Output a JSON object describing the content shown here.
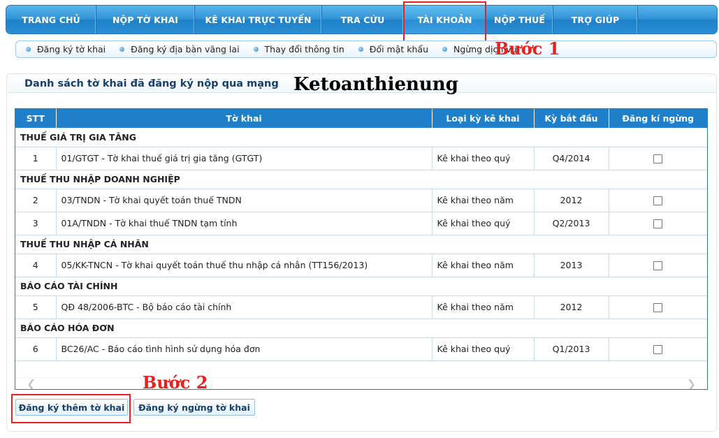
{
  "nav": {
    "items": [
      {
        "label": "TRANG CHỦ"
      },
      {
        "label": "NỘP TỜ KHAI"
      },
      {
        "label": "KÊ KHAI TRỰC TUYẾN"
      },
      {
        "label": "TRA CỨU"
      },
      {
        "label": "TÀI KHOẢN"
      },
      {
        "label": "NỘP THUẾ"
      },
      {
        "label": "TRỢ GIÚP"
      }
    ],
    "active": "TÀI KHOẢN"
  },
  "subnav": {
    "items": [
      {
        "label": "Đăng ký tờ khai"
      },
      {
        "label": "Đăng ký địa bàn vãng lai"
      },
      {
        "label": "Thay đổi thông tin"
      },
      {
        "label": "Đổi mật khẩu"
      },
      {
        "label": "Ngừng dịch vụ"
      }
    ]
  },
  "annotations": {
    "step1": "Bước 1",
    "step2": "Bước 2",
    "watermark": "Ketoanthienung",
    "highlight_color": "#e8211d"
  },
  "panel": {
    "title": "Danh sách tờ khai đã đăng ký nộp qua mạng"
  },
  "table": {
    "headers": [
      "STT",
      "Tờ khai",
      "Loại kỳ kê khai",
      "Kỳ bắt đầu",
      "Đăng kí ngừng"
    ],
    "groups": [
      {
        "name": "THUẾ GIÁ TRỊ GIA TĂNG",
        "rows": [
          {
            "stt": "1",
            "form": "01/GTGT - Tờ khai thuế giá trị gia tăng (GTGT)",
            "period_type": "Kê khai theo quý",
            "start": "Q4/2014",
            "checked": false
          }
        ]
      },
      {
        "name": "THUẾ THU NHẬP DOANH NGHIỆP",
        "rows": [
          {
            "stt": "2",
            "form": "03/TNDN - Tờ khai quyết toán thuế TNDN",
            "period_type": "Kê khai theo năm",
            "start": "2012",
            "checked": false
          },
          {
            "stt": "3",
            "form": "01A/TNDN - Tờ khai thuế TNDN tạm tính",
            "period_type": "Kê khai theo quý",
            "start": "Q2/2013",
            "checked": false
          }
        ]
      },
      {
        "name": "THUẾ THU NHẬP CÁ NHÂN",
        "rows": [
          {
            "stt": "4",
            "form": "05/KK-TNCN - Tờ khai quyết toán thuế thu nhập cá nhân (TT156/2013)",
            "period_type": "Kê khai theo năm",
            "start": "2013",
            "checked": false
          }
        ]
      },
      {
        "name": "BÁO CÁO TÀI CHÍNH",
        "rows": [
          {
            "stt": "5",
            "form": "QĐ 48/2006-BTC - Bộ báo cáo tài chính",
            "period_type": "Kê khai theo năm",
            "start": "2012",
            "checked": false
          }
        ]
      },
      {
        "name": "BÁO CÁO HÓA ĐƠN",
        "rows": [
          {
            "stt": "6",
            "form": "BC26/AC - Báo cáo tình hình sử dụng hóa đơn",
            "period_type": "Kê khai theo quý",
            "start": "Q1/2013",
            "checked": false
          }
        ]
      }
    ]
  },
  "buttons": {
    "register_more": "Đăng ký thêm tờ khai",
    "register_stop": "Đăng ký ngừng tờ khai"
  },
  "colors": {
    "nav_blue": "#2f93d6",
    "header_blue": "#1f7fc9",
    "title_navy": "#16406c"
  }
}
